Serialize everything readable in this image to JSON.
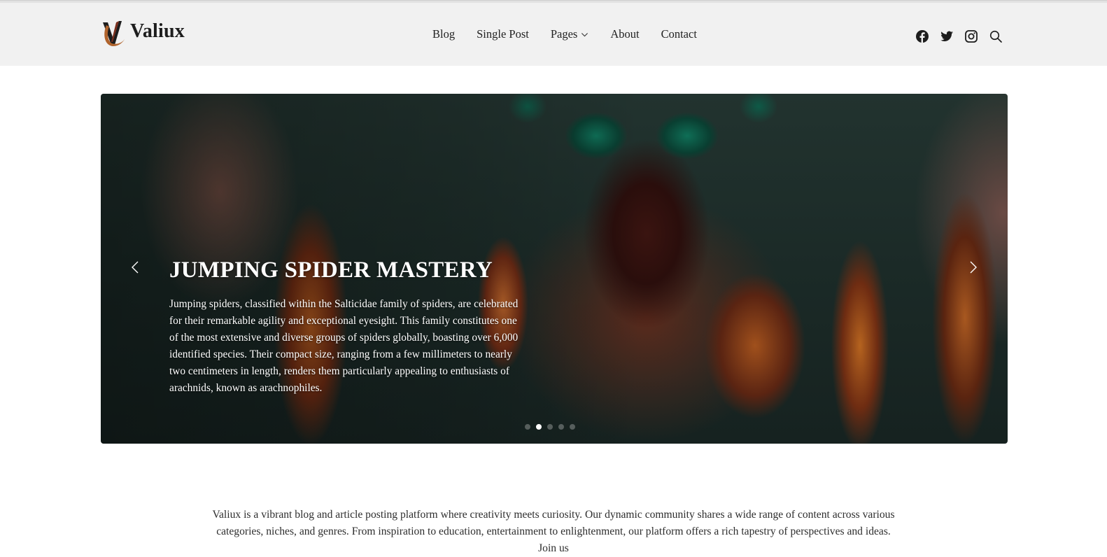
{
  "header": {
    "brand": "Valiux",
    "nav": [
      {
        "label": "Blog"
      },
      {
        "label": "Single Post"
      },
      {
        "label": "Pages",
        "has_dropdown": true
      },
      {
        "label": "About"
      },
      {
        "label": "Contact"
      }
    ],
    "social_icons": [
      "facebook-icon",
      "twitter-icon",
      "instagram-icon",
      "search-icon"
    ]
  },
  "slider": {
    "title": "JUMPING SPIDER MASTERY",
    "body": "Jumping spiders, classified within the Salticidae family of spiders, are celebrated for their remarkable agility and exceptional eyesight. This family constitutes one of the most extensive and diverse groups of spiders globally, boasting over 6,000 identified species. Their compact size, ranging from a few millimeters to nearly two centimeters in length, renders them particularly appealing to enthusiasts of arachnids, known as arachnophiles.",
    "slide_count": 5,
    "active_slide": 2
  },
  "intro": {
    "text": "Valiux is a vibrant blog and article posting platform where creativity meets curiosity. Our dynamic community shares a wide range of content across various categories, niches, and genres. From inspiration to education, entertainment to enlightenment, our platform offers a rich tapestry of perspectives and ideas. Join us"
  },
  "colors": {
    "header_bg": "#f1f1f1",
    "text": "#222222",
    "hero_text": "#ffffff"
  }
}
